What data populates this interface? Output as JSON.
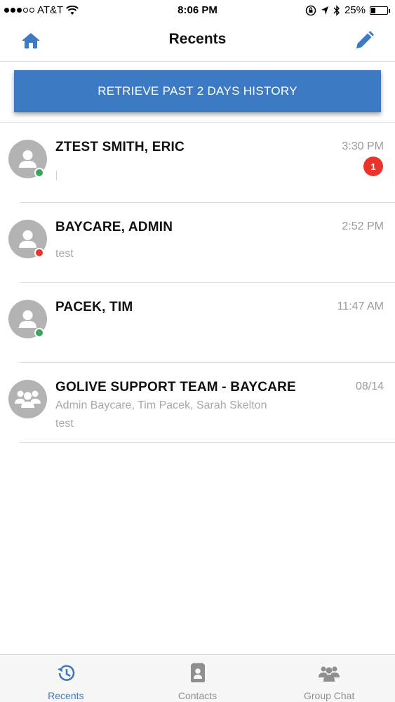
{
  "status_bar": {
    "carrier": "AT&T",
    "time": "8:06 PM",
    "battery": "25%",
    "battery_level": 0.25
  },
  "nav": {
    "title": "Recents",
    "home_icon": "home-icon",
    "edit_icon": "pencil-icon"
  },
  "retrieve_button": {
    "label": "RETRIEVE PAST 2 DAYS HISTORY"
  },
  "conversations": [
    {
      "name": "ZTEST SMITH, ERIC",
      "time": "3:30 PM",
      "unread": "1",
      "presence": "online",
      "preview": ""
    },
    {
      "name": "BAYCARE, ADMIN",
      "time": "2:52 PM",
      "presence": "busy",
      "preview": "test"
    },
    {
      "name": "PACEK, TIM",
      "time": "11:47 AM",
      "presence": "online",
      "preview": ""
    },
    {
      "name": "GOLIVE SUPPORT TEAM - BAYCARE",
      "time": "08/14",
      "members": "Admin Baycare, Tim Pacek, Sarah Skelton",
      "preview": "test"
    }
  ],
  "colors": {
    "accent": "#3c7bc4",
    "online": "#3aa55c",
    "busy": "#e8342a",
    "badge": "#e8342a"
  },
  "tabs": [
    {
      "label": "Recents",
      "icon": "history-icon",
      "active": true
    },
    {
      "label": "Contacts",
      "icon": "contacts-icon",
      "active": false
    },
    {
      "label": "Group Chat",
      "icon": "group-icon",
      "active": false
    }
  ]
}
